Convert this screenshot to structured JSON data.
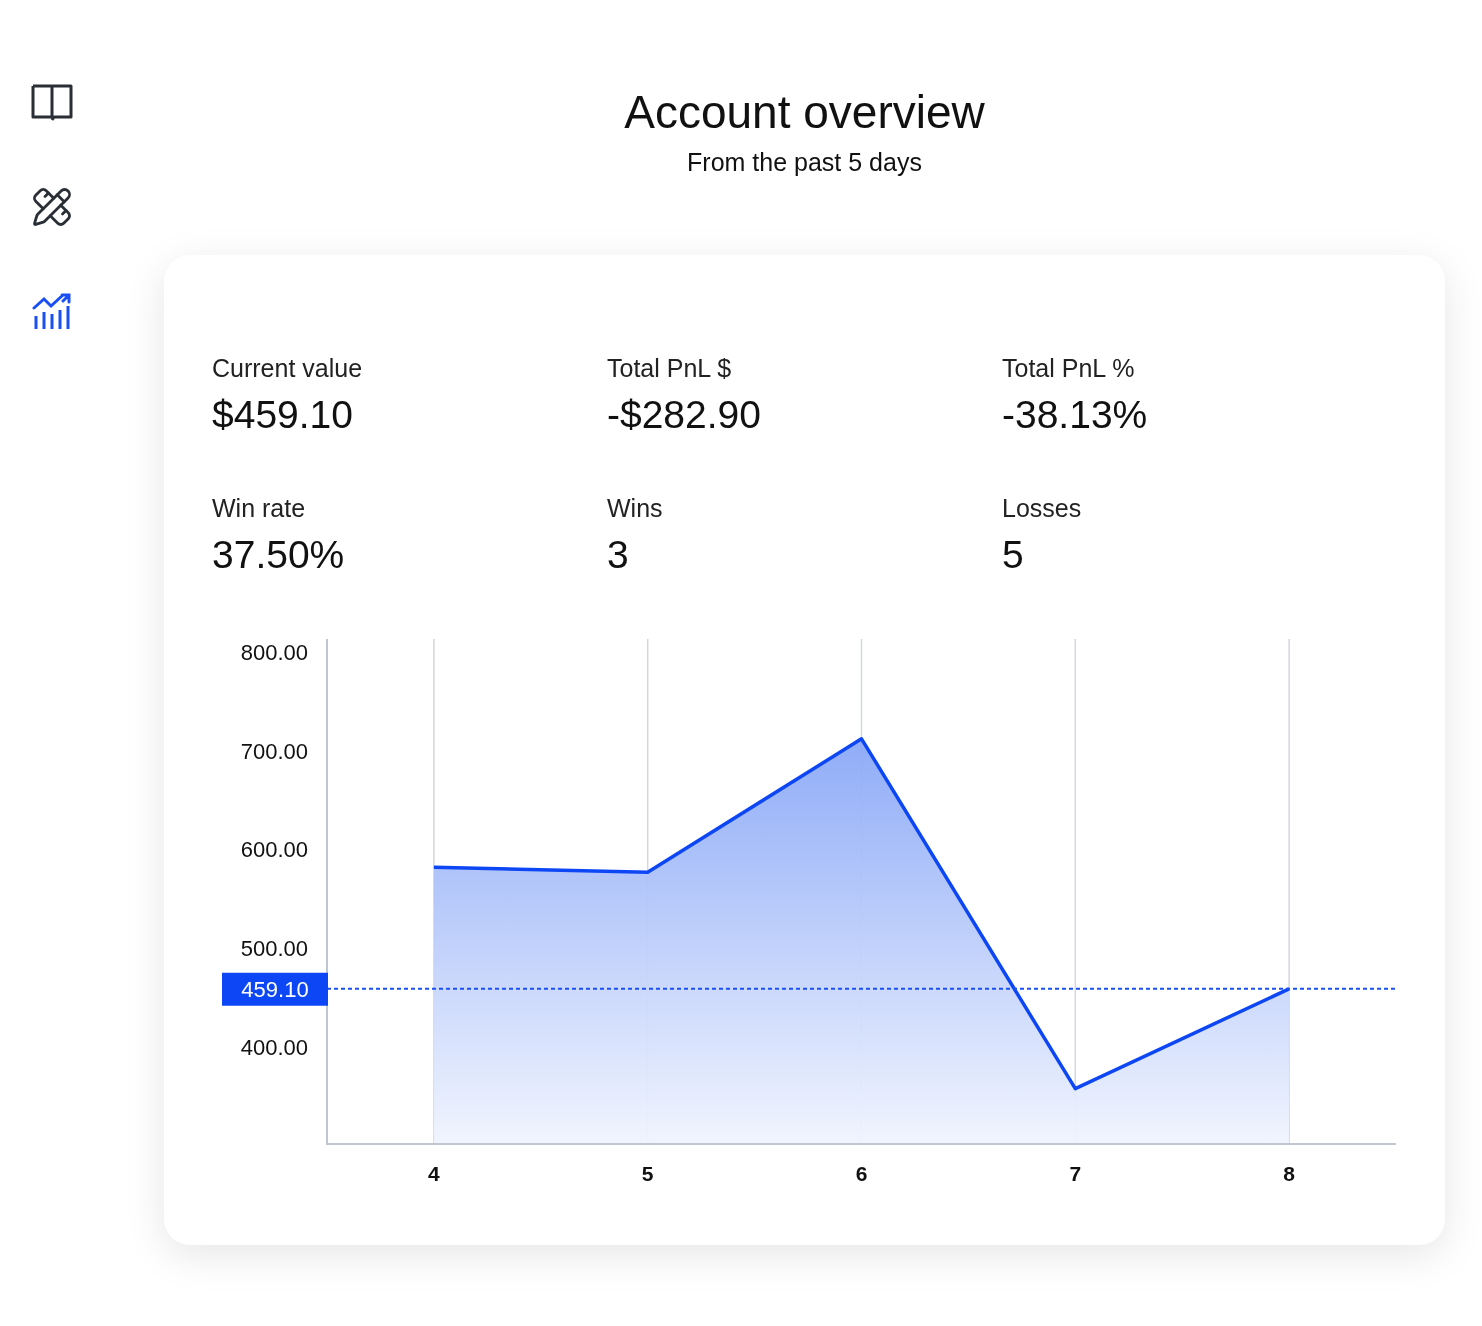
{
  "sidebar": {
    "items": [
      {
        "kind": "book",
        "selected": false
      },
      {
        "kind": "tools",
        "selected": false
      },
      {
        "kind": "chart",
        "selected": true
      }
    ]
  },
  "header": {
    "title": "Account overview",
    "subtitle": "From the past 5 days"
  },
  "stats": [
    {
      "label": "Current value",
      "value": "$459.10"
    },
    {
      "label": "Total PnL $",
      "value": "-$282.90"
    },
    {
      "label": "Total PnL %",
      "value": "-38.13%"
    },
    {
      "label": "Win rate",
      "value": "37.50%"
    },
    {
      "label": "Wins",
      "value": "3"
    },
    {
      "label": "Losses",
      "value": "5"
    }
  ],
  "chart_data": {
    "type": "area",
    "x": [
      4,
      5,
      6,
      7,
      8
    ],
    "series": [
      {
        "color": "#0d47f5",
        "values": [
          582,
          577,
          712,
          358,
          459
        ]
      }
    ],
    "xlim": [
      3.5,
      8.5
    ],
    "ylim": [
      302,
      813
    ],
    "xticks": [
      4,
      5,
      6,
      7,
      8
    ],
    "yticks": [
      {
        "value": 400,
        "label": "400.00"
      },
      {
        "value": 500,
        "label": "500.00"
      },
      {
        "value": 600,
        "label": "600.00"
      },
      {
        "value": 700,
        "label": "700.00"
      },
      {
        "value": 800,
        "label": "800.00"
      }
    ],
    "grid": "x",
    "ref_lines": [
      {
        "axis": "y",
        "value": 459.1,
        "label": "459.10"
      }
    ]
  }
}
